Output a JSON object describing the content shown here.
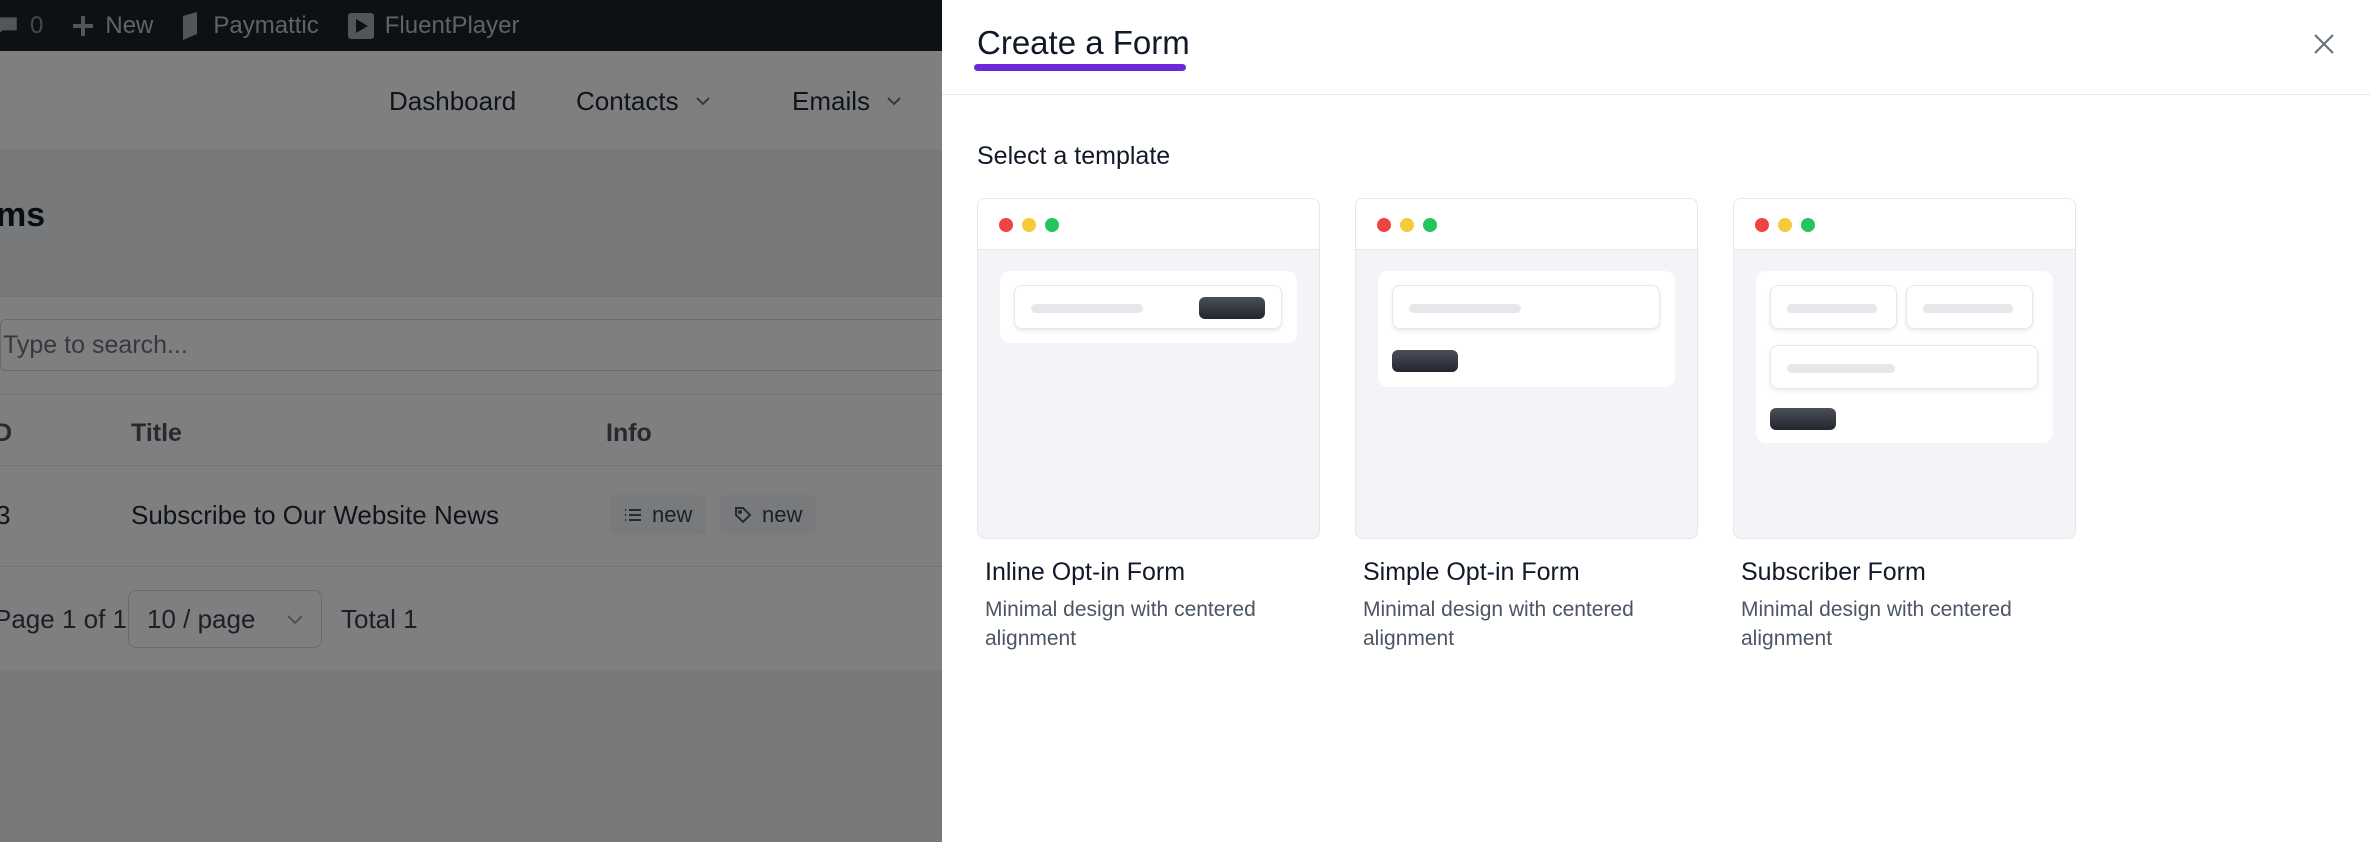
{
  "admin_bar": {
    "comments_count": "0",
    "new_label": "New",
    "paymattic_label": "Paymattic",
    "fluentplayer_label": "FluentPlayer"
  },
  "nav": {
    "items": [
      {
        "label": "Dashboard"
      },
      {
        "label": "Contacts"
      },
      {
        "label": "Emails"
      }
    ]
  },
  "page": {
    "title_fragment": "ms",
    "search_placeholder": "Type to search...",
    "columns": [
      "D",
      "Title",
      "Info"
    ],
    "rows": [
      {
        "id": "3",
        "title": "Subscribe to Our Website News",
        "tags": [
          "new",
          "new"
        ]
      }
    ],
    "pagination": {
      "page_info": "Page 1 of 1",
      "page_size": "10 / page",
      "total": "Total 1"
    }
  },
  "drawer": {
    "title": "Create a Form",
    "subtitle": "Select a template",
    "accent_color": "#6d28d9",
    "templates": [
      {
        "name": "Inline Opt-in Form",
        "description": "Minimal design with centered alignment"
      },
      {
        "name": "Simple Opt-in Form",
        "description": "Minimal design with centered alignment"
      },
      {
        "name": "Subscriber Form",
        "description": "Minimal design with centered alignment"
      }
    ]
  }
}
